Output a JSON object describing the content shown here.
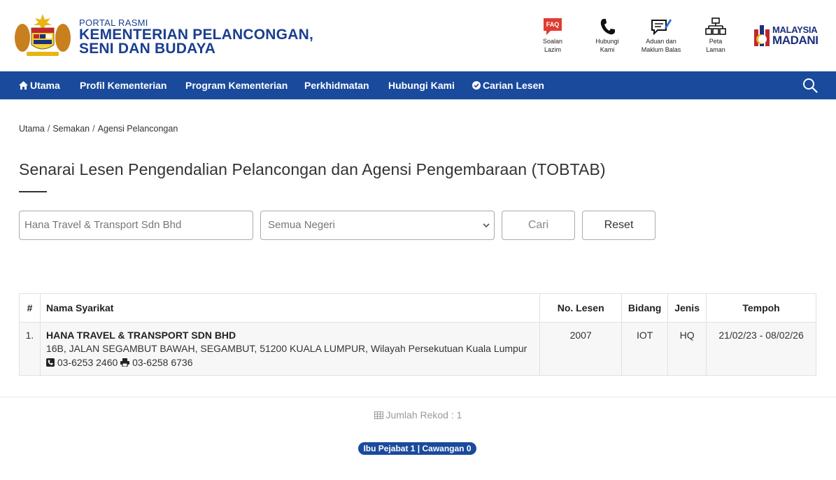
{
  "header": {
    "portal_label": "PORTAL RASMI",
    "ministry_line1": "KEMENTERIAN PELANCONGAN,",
    "ministry_line2": "SENI DAN BUDAYA",
    "quick_links": [
      {
        "line1": "Soalan",
        "line2": "Lazim",
        "icon": "faq-icon",
        "badge": "FAQ"
      },
      {
        "line1": "Hubungi",
        "line2": "Kami",
        "icon": "phone-icon"
      },
      {
        "line1": "Aduan dan",
        "line2": "Maklum Balas",
        "icon": "feedback-icon"
      },
      {
        "line1": "Peta",
        "line2": "Laman",
        "icon": "sitemap-icon"
      }
    ],
    "madani_line1": "MALAYSIA",
    "madani_line2": "MADANI"
  },
  "nav": {
    "items": [
      "Utama",
      "Profil Kementerian",
      "Program Kementerian",
      "Perkhidmatan",
      "Hubungi Kami",
      "Carian Lesen"
    ]
  },
  "breadcrumb": [
    "Utama",
    "Semakan",
    "Agensi Pelancongan"
  ],
  "page_title": "Senarai Lesen Pengendalian Pelancongan dan Agensi Pengembaraan (TOBTAB)",
  "search": {
    "name_value": "Hana Travel & Transport Sdn Bhd",
    "state_value": "Semua Negeri",
    "cari_label": "Cari",
    "reset_label": "Reset"
  },
  "table": {
    "headers": [
      "#",
      "Nama Syarikat",
      "No. Lesen",
      "Bidang",
      "Jenis",
      "Tempoh"
    ],
    "rows": [
      {
        "no": "1.",
        "company": "HANA TRAVEL & TRANSPORT SDN BHD",
        "address": "16B, JALAN SEGAMBUT BAWAH, SEGAMBUT, 51200 KUALA LUMPUR, Wilayah Persekutuan Kuala Lumpur",
        "phone": "03-6253 2460",
        "fax": "03-6258 6736",
        "license": "2007",
        "bidang": "IOT",
        "jenis": "HQ",
        "tempoh": "21/02/23 - 08/02/26"
      }
    ]
  },
  "footer": {
    "jumlah": "Jumlah Rekod : 1",
    "badge": "Ibu Pejabat 1 | Cawangan 0"
  },
  "colors": {
    "primary": "#1a4a9c",
    "brand_text": "#1a3f8f"
  }
}
